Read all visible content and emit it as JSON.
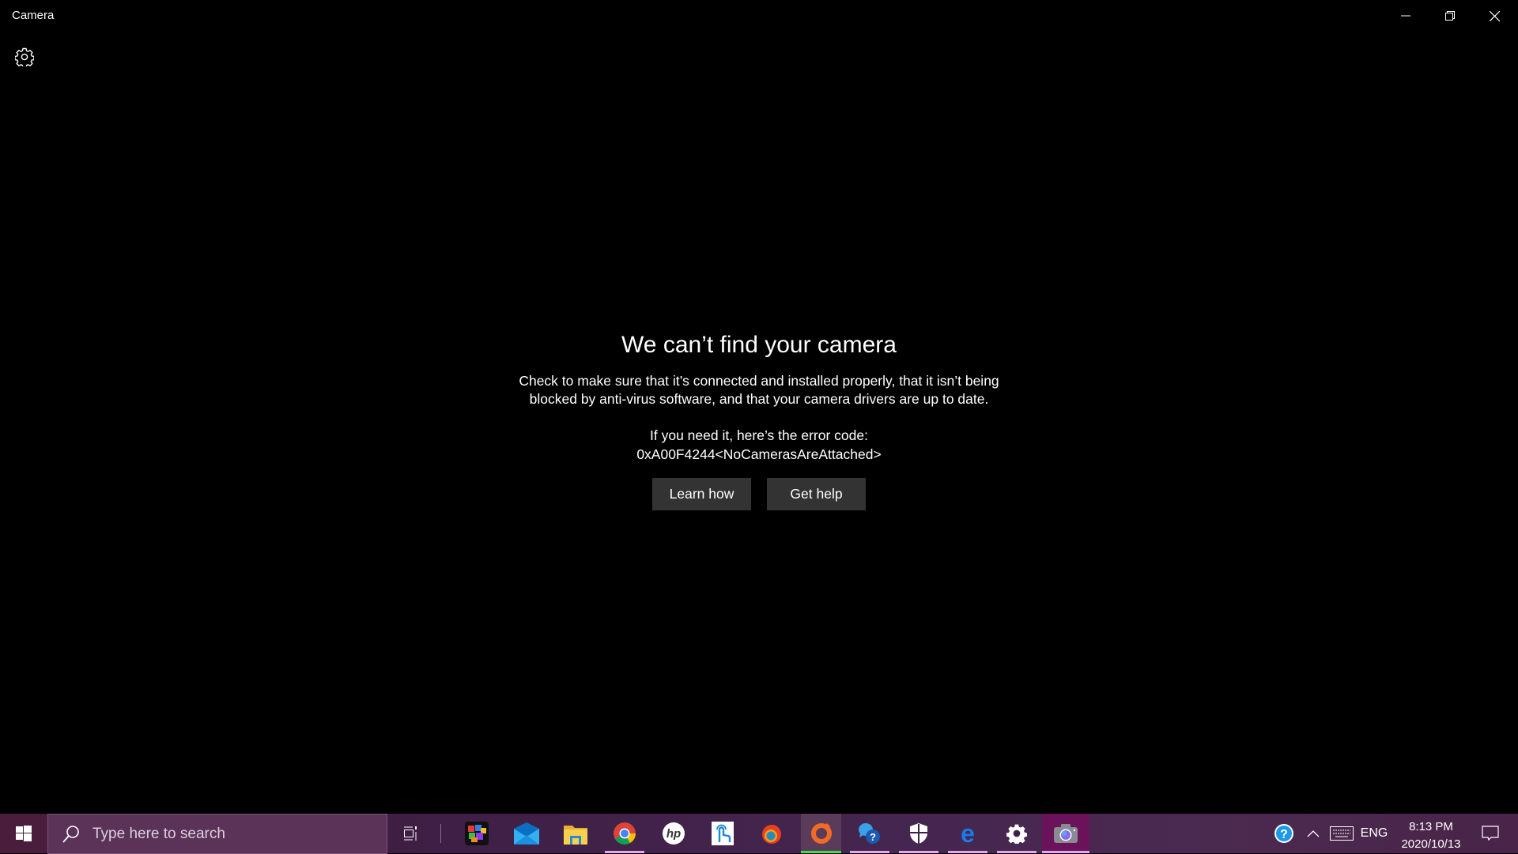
{
  "window": {
    "title": "Camera",
    "controls": {
      "minimize_icon": "minimize-icon",
      "restore_icon": "restore-icon",
      "close_icon": "close-icon"
    },
    "settings_icon": "gear-icon"
  },
  "error": {
    "title": "We can’t find your camera",
    "description_line1": "Check to make sure that it’s connected and installed properly, that it isn’t being",
    "description_line2": "blocked by anti-virus software, and that your camera drivers are up to date.",
    "code_label": "If you need it, here’s the error code:",
    "code": "0xA00F4244<NoCamerasAreAttached>",
    "buttons": {
      "learn_how": "Learn how",
      "get_help": "Get help"
    }
  },
  "taskbar": {
    "start_icon": "windows-logo-icon",
    "search_placeholder": "Type here to search",
    "task_view_icon": "task-view-icon",
    "pinned_apps": [
      {
        "name": "puzzle-app",
        "running": false
      },
      {
        "name": "mail",
        "running": false
      },
      {
        "name": "file-explorer",
        "running": false
      },
      {
        "name": "chrome",
        "running": true
      },
      {
        "name": "hp",
        "running": false
      },
      {
        "name": "touch-app",
        "running": false
      },
      {
        "name": "firefox-nightly",
        "running": false
      },
      {
        "name": "origin",
        "running": true
      },
      {
        "name": "get-help",
        "running": true
      },
      {
        "name": "windows-security",
        "running": true
      },
      {
        "name": "edge",
        "running": true
      },
      {
        "name": "settings",
        "running": true
      },
      {
        "name": "camera",
        "running": true,
        "active": true
      }
    ],
    "tray": {
      "help_icon": "help-icon",
      "chevron_icon": "chevron-up-icon",
      "keyboard_icon": "keyboard-icon",
      "language": "ENG",
      "time": "8:13 PM",
      "date": "2020/10/13",
      "notification_icon": "notification-icon"
    },
    "colors": {
      "running_indicator": "#e8a9e8",
      "origin_indicator": "#44dd44",
      "active_app_bg": "#6a135a"
    }
  }
}
